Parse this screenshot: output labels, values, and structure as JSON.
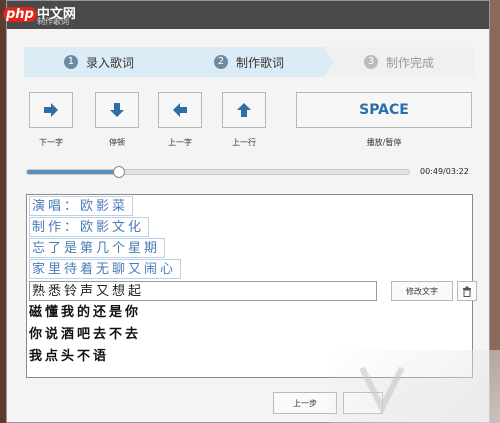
{
  "window": {
    "logo_tag": "php",
    "logo_text": "中文网",
    "title": "制作歌词"
  },
  "steps": [
    {
      "num": "1",
      "label": "录入歌词"
    },
    {
      "num": "2",
      "label": "制作歌词"
    },
    {
      "num": "3",
      "label": "制作完成"
    }
  ],
  "controls": [
    {
      "label": "下一字",
      "icon": "arrow-right-icon"
    },
    {
      "label": "停顿",
      "icon": "arrow-down-icon"
    },
    {
      "label": "上一字",
      "icon": "arrow-left-icon"
    },
    {
      "label": "上一行",
      "icon": "arrow-up-icon"
    }
  ],
  "space": {
    "label": "SPACE",
    "caption": "播放/暂停"
  },
  "progress": {
    "time": "00:49/03:22",
    "fraction": 0.24
  },
  "lyrics": [
    {
      "text": "演唱：欧影菜",
      "state": "done"
    },
    {
      "text": "制作：欧影文化",
      "state": "done"
    },
    {
      "text": "忘了是第几个星期",
      "state": "done"
    },
    {
      "text": "家里待着无聊又闹心",
      "state": "done"
    },
    {
      "text": "熟悉铃声又想起",
      "state": "active"
    },
    {
      "text": "磁懂我的还是你",
      "state": "pending"
    },
    {
      "text": "你说酒吧去不去",
      "state": "pending"
    },
    {
      "text": "我点头不语",
      "state": "pending"
    }
  ],
  "buttons": {
    "edit": "修改文字",
    "prev": "上一步"
  },
  "colors": {
    "accent": "#4a7cb5",
    "space_text": "#2a6ea8",
    "step_active": "#dcecf7"
  }
}
